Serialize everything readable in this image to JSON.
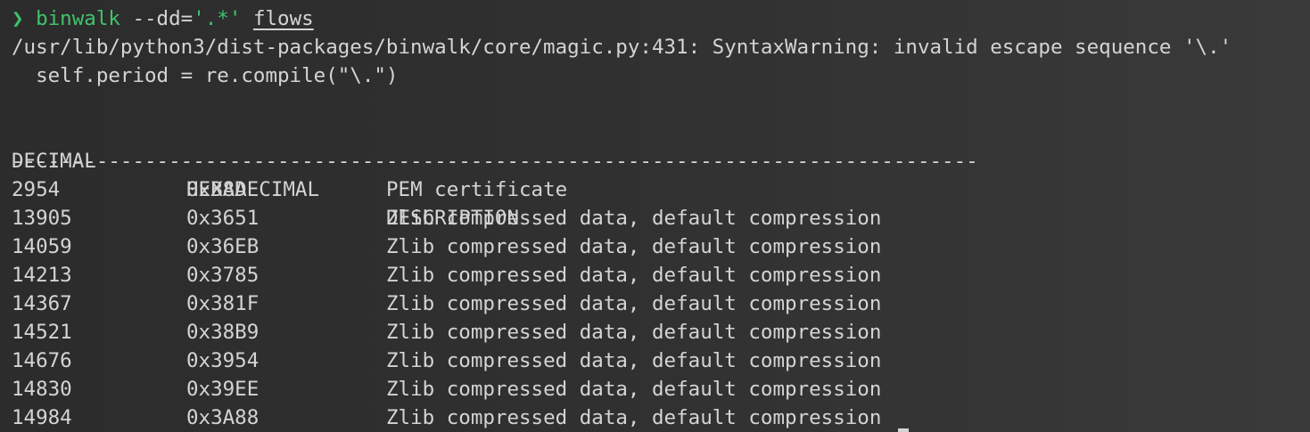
{
  "prompt": {
    "symbol": "❯",
    "command": "binwalk",
    "flag": "--dd=",
    "pattern": "'.*'",
    "target": "flows"
  },
  "warning": {
    "line1": "/usr/lib/python3/dist-packages/binwalk/core/magic.py:431: SyntaxWarning: invalid escape sequence '\\.'",
    "line2": "  self.period = re.compile(\"\\.\")"
  },
  "table": {
    "headers": [
      "DECIMAL",
      "HEXADECIMAL",
      "DESCRIPTION"
    ],
    "separator": "--------------------------------------------------------------------------------",
    "rows": [
      {
        "decimal": "2954",
        "hex": "0xB8A",
        "desc": "PEM certificate"
      },
      {
        "decimal": "13905",
        "hex": "0x3651",
        "desc": "Zlib compressed data, default compression"
      },
      {
        "decimal": "14059",
        "hex": "0x36EB",
        "desc": "Zlib compressed data, default compression"
      },
      {
        "decimal": "14213",
        "hex": "0x3785",
        "desc": "Zlib compressed data, default compression"
      },
      {
        "decimal": "14367",
        "hex": "0x381F",
        "desc": "Zlib compressed data, default compression"
      },
      {
        "decimal": "14521",
        "hex": "0x38B9",
        "desc": "Zlib compressed data, default compression"
      },
      {
        "decimal": "14676",
        "hex": "0x3954",
        "desc": "Zlib compressed data, default compression"
      },
      {
        "decimal": "14830",
        "hex": "0x39EE",
        "desc": "Zlib compressed data, default compression"
      },
      {
        "decimal": "14984",
        "hex": "0x3A88",
        "desc": "Zlib compressed data, default compression"
      }
    ]
  },
  "colors": {
    "background": "#2c2c2c",
    "text": "#d4d4d4",
    "accent": "#3fc46b"
  }
}
